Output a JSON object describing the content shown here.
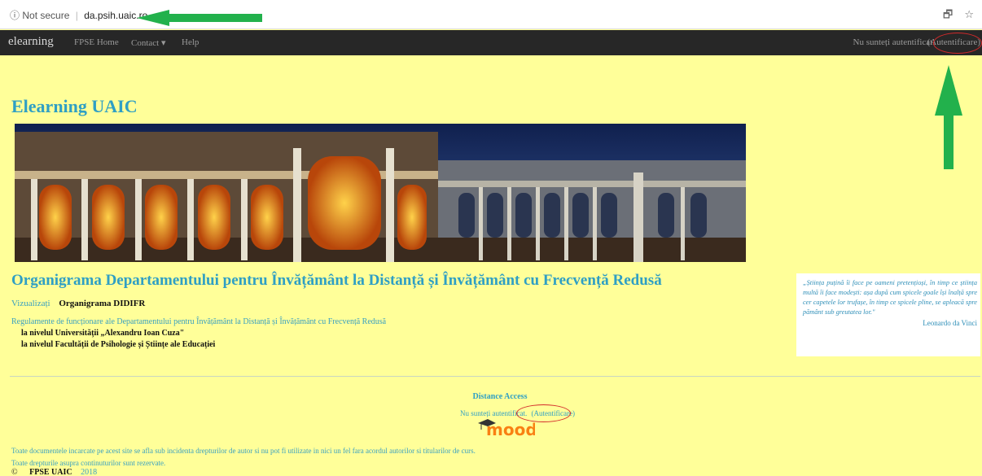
{
  "browser": {
    "security_label": "Not secure",
    "host": "da.psih.uaic.ro",
    "info_icon": "info-circle-icon",
    "translate_icon": "translate-icon",
    "star_icon": "star-icon"
  },
  "navbar": {
    "brand": "elearning",
    "items": [
      "FPSE Home",
      "Contact ▾",
      "Help"
    ],
    "login_text": "Nu sunteți autentificat.",
    "login_link": "(Autentificare)"
  },
  "main": {
    "site_title": "Elearning UAIC",
    "heading": "Organigrama Departamentului pentru Învățământ la Distanță și Învățământ cu Frecvență Redusă",
    "view_label": "Vizualizați",
    "view_value": "Organigrama DIDIFR",
    "regulations": "Regulamente de funcționare ale Departamentului pentru Învățământ la Distanță și Învățământ cu Frecvență Redusă",
    "reg_university": "la nivelul Universității „Alexandru Ioan Cuza\"",
    "reg_faculty": "la nivelul Facultății de Psihologie și Științe ale Educației"
  },
  "quote": {
    "text": "„Știința puțină îi face pe oameni pretențioși, în timp ce știința multă îi face modești: așa după cum spicele goale își înalță spre cer capetele lor trufașe, în timp ce spicele pline, se apleacă spre pământ sub greutatea lor.\"",
    "author": "Leonardo da Vinci"
  },
  "footer": {
    "title": "Distance Access",
    "login_text": "Nu sunteți autentificat.",
    "login_link": "(Autentificare)",
    "moodle_logo": "moodle",
    "copyright_line1": "Toate documentele incarcate pe acest site se afla sub incidenta drepturilor de autor si nu pot fi utilizate in nici un fel fara acordul autorilor si titularilor de curs.",
    "copyright_line2": "Toate drepturile asupra continuturilor sunt rezervate.",
    "copyright_symbol": "©",
    "org": "FPSE UAIC",
    "year": "2018"
  },
  "colors": {
    "page_bg": "#ffff99",
    "link_blue": "#2f9fc4",
    "navbar_bg": "#272727",
    "annotation_red": "#d32a2a",
    "annotation_green": "#22b14c",
    "moodle_orange": "#f98012"
  }
}
